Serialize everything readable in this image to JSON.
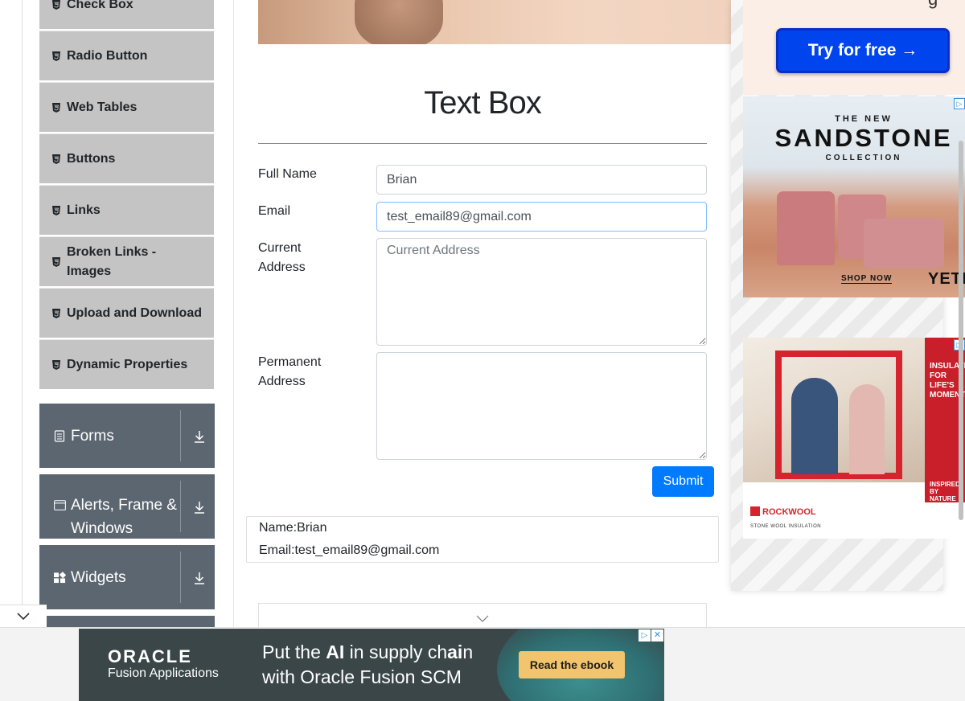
{
  "sidebar": {
    "elements_items": [
      {
        "label": "Check Box"
      },
      {
        "label": "Radio Button"
      },
      {
        "label": "Web Tables"
      },
      {
        "label": "Buttons"
      },
      {
        "label": "Links"
      },
      {
        "label": "Broken Links - Images"
      },
      {
        "label": "Upload and Download"
      },
      {
        "label": "Dynamic Properties"
      }
    ],
    "groups": [
      {
        "label": "Forms",
        "icon": "form-icon"
      },
      {
        "label": "Alerts, Frame & Windows",
        "icon": "window-icon"
      },
      {
        "label": "Widgets",
        "icon": "widgets-icon"
      }
    ]
  },
  "main": {
    "title": "Text Box",
    "form": {
      "full_name_label": "Full Name",
      "full_name_value": "Brian",
      "email_label": "Email",
      "email_value": "test_email89@gmail.com",
      "current_address_label": "Current Address",
      "current_address_placeholder": "Current Address",
      "permanent_address_label": "Permanent Address",
      "submit_label": "Submit"
    },
    "output": {
      "name_line": "Name:Brian",
      "email_line": "Email:test_email89@gmail.com"
    }
  },
  "ads": {
    "top": {
      "cta": "Try for free →",
      "fragment": "g"
    },
    "yeti": {
      "line1": "THE NEW",
      "line2": "SANDSTONE",
      "line3": "COLLECTION",
      "shop": "SHOP NOW",
      "brand": "YETI"
    },
    "rockwool": {
      "side_text": "INSULATION FOR LIFE'S MOMENTS",
      "side_text2": "INSPIRED BY NATURE",
      "logo": "ROCKWOOL",
      "sub": "STONE WOOL INSULATION"
    },
    "oracle": {
      "brand": "ORACLE",
      "sub": "Fusion Applications",
      "headline1_pre": "Put the ",
      "headline1_bold": "AI",
      "headline1_mid": " in supply ch",
      "headline1_bold2": "ai",
      "headline1_post": "n",
      "headline2": "with Oracle Fusion SCM",
      "cta": "Read the ebook"
    }
  },
  "colors": {
    "primary": "#007bff",
    "sidebar_item_bg": "#c4c4c4",
    "sidebar_group_bg": "#5c6670"
  }
}
